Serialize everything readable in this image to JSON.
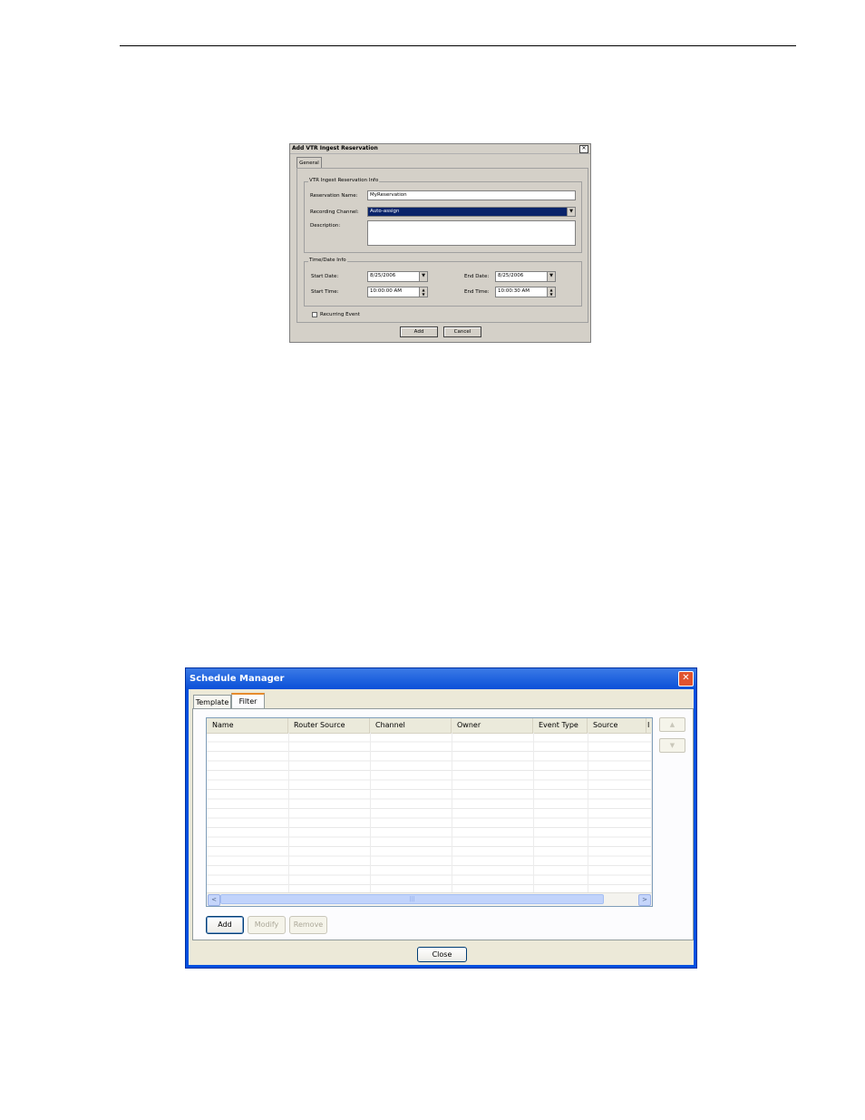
{
  "dialog1": {
    "title": "Add VTR Ingest Reservation",
    "close_symbol": "✕",
    "tab": "General",
    "info_group": {
      "label": "VTR Ingest Reservation Info",
      "reservation_name_label": "Reservation Name:",
      "reservation_name_value": "MyReservation",
      "recording_channel_label": "Recording Channel:",
      "recording_channel_value": "Auto-assign",
      "description_label": "Description:",
      "description_value": ""
    },
    "time_group": {
      "label": "Time/Date Info",
      "start_date_label": "Start Date:",
      "start_date_value": "8/25/2006",
      "end_date_label": "End Date:",
      "end_date_value": "8/25/2006",
      "start_time_label": "Start Time:",
      "start_time_value": "10:00:00 AM",
      "end_time_label": "End Time:",
      "end_time_value": "10:00:30 AM"
    },
    "recurring_label": "Recurring Event",
    "add_label": "Add",
    "cancel_label": "Cancel"
  },
  "dialog2": {
    "title": "Schedule Manager",
    "close_symbol": "✕",
    "tabs": [
      "Template",
      "Filter"
    ],
    "active_tab": "Filter",
    "columns": [
      "Name",
      "Router Source",
      "Channel",
      "Owner",
      "Event Type",
      "Source",
      "I"
    ],
    "scroll_left": "<",
    "scroll_right": ">",
    "scroll_grip": "|||",
    "add_label": "Add",
    "modify_label": "Modify",
    "remove_label": "Remove",
    "close_label": "Close",
    "move_up_symbol": "▲",
    "move_down_symbol": "▼"
  }
}
